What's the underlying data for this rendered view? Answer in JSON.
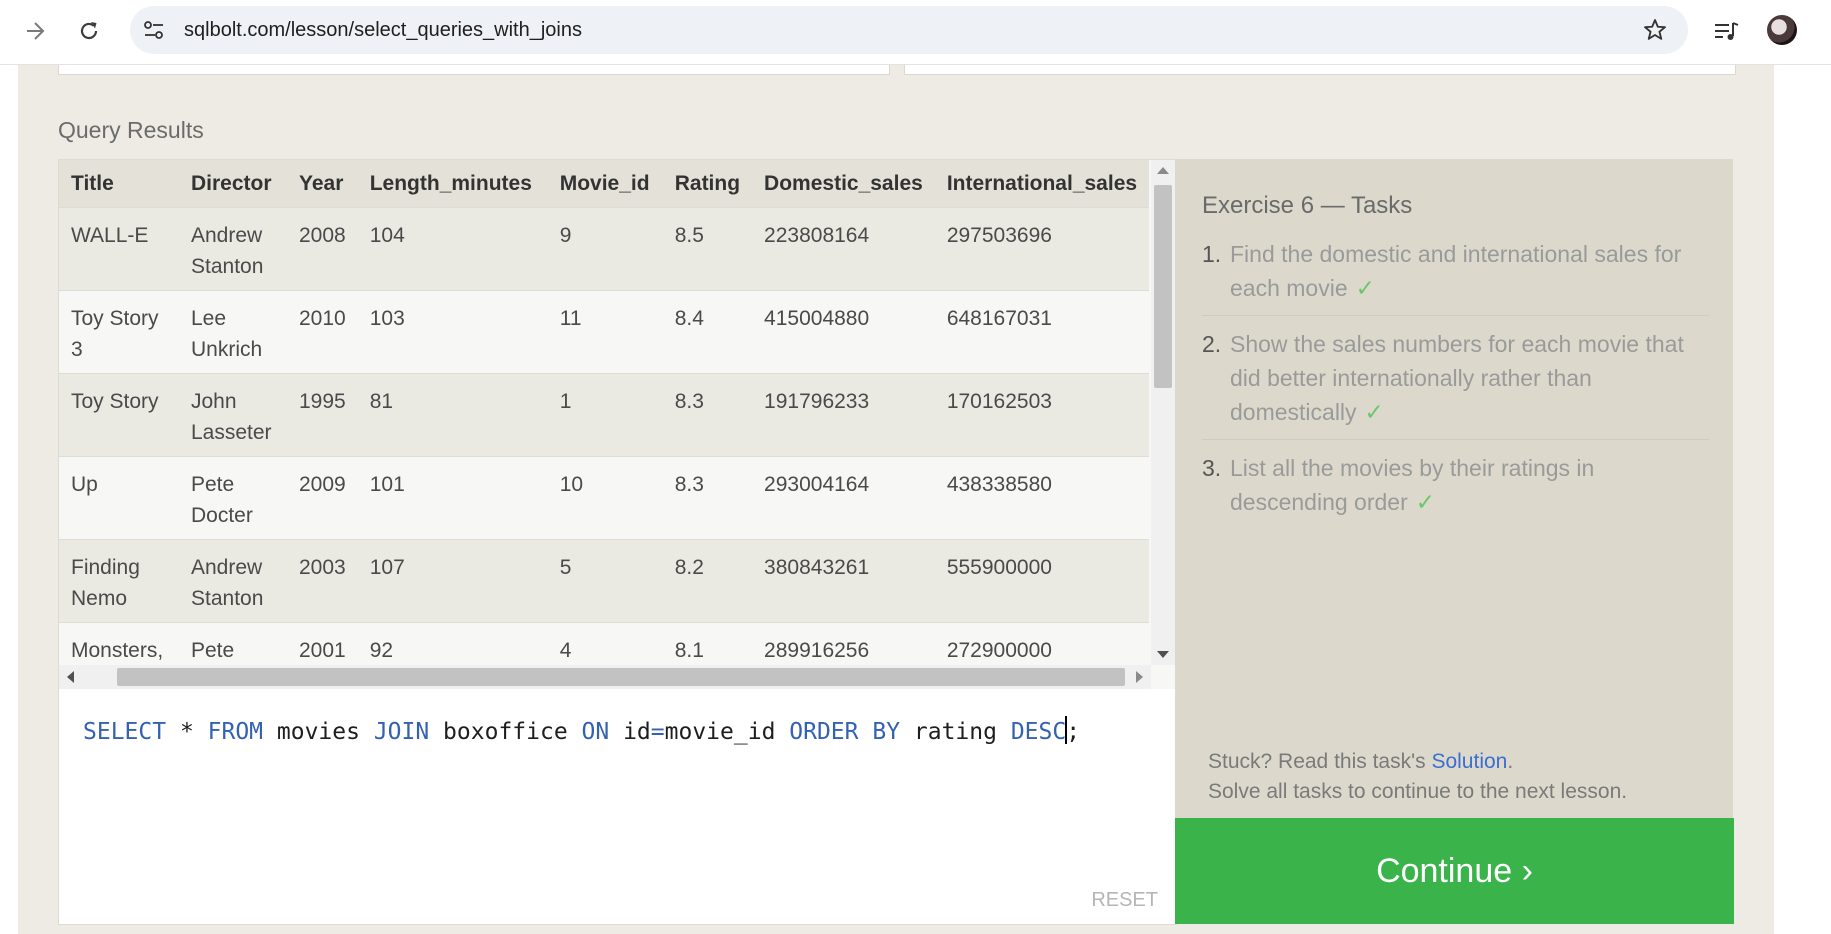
{
  "browser": {
    "url": "sqlbolt.com/lesson/select_queries_with_joins",
    "icons": [
      "back-arrow-icon",
      "reload-icon",
      "site-settings-icon",
      "bookmark-star-icon",
      "media-control-icon",
      "profile-avatar"
    ]
  },
  "results": {
    "label": "Query Results",
    "columns": [
      "Title",
      "Director",
      "Year",
      "Length_minutes",
      "Movie_id",
      "Rating",
      "Domestic_sales",
      "International_sales"
    ],
    "rows": [
      [
        "WALL-E",
        "Andrew Stanton",
        "2008",
        "104",
        "9",
        "8.5",
        "223808164",
        "297503696"
      ],
      [
        "Toy Story 3",
        "Lee Unkrich",
        "2010",
        "103",
        "11",
        "8.4",
        "415004880",
        "648167031"
      ],
      [
        "Toy Story",
        "John Lasseter",
        "1995",
        "81",
        "1",
        "8.3",
        "191796233",
        "170162503"
      ],
      [
        "Up",
        "Pete Docter",
        "2009",
        "101",
        "10",
        "8.3",
        "293004164",
        "438338580"
      ],
      [
        "Finding Nemo",
        "Andrew Stanton",
        "2003",
        "107",
        "5",
        "8.2",
        "380843261",
        "555900000"
      ],
      [
        "Monsters, Inc.",
        "Pete Docter",
        "2001",
        "92",
        "4",
        "8.1",
        "289916256",
        "272900000"
      ]
    ]
  },
  "editor": {
    "tokens": [
      {
        "t": "SELECT",
        "kw": true
      },
      {
        "t": " * ",
        "kw": false
      },
      {
        "t": "FROM",
        "kw": true
      },
      {
        "t": " movies ",
        "kw": false
      },
      {
        "t": "JOIN",
        "kw": true
      },
      {
        "t": " boxoffice ",
        "kw": false
      },
      {
        "t": "ON",
        "kw": true
      },
      {
        "t": " id",
        "kw": false
      },
      {
        "t": "=",
        "kw": true
      },
      {
        "t": "movie_id ",
        "kw": false
      },
      {
        "t": "ORDER BY",
        "kw": true
      },
      {
        "t": " rating ",
        "kw": false
      },
      {
        "t": "DESC",
        "kw": true
      },
      {
        "t": "|",
        "kw": false
      },
      {
        "t": ";",
        "kw": false
      }
    ],
    "reset_label": "RESET"
  },
  "tasks": {
    "title": "Exercise 6 — Tasks",
    "items": [
      {
        "num": "1.",
        "text": "Find the domestic and international sales for each movie",
        "done": "✓"
      },
      {
        "num": "2.",
        "text": "Show the sales numbers for each movie that did better internationally rather than domestically",
        "done": "✓"
      },
      {
        "num": "3.",
        "text": "List all the movies by their ratings in descending order",
        "done": "✓"
      }
    ],
    "help_prefix": "Stuck? Read this task's ",
    "help_link": "Solution",
    "help_suffix": ".",
    "help_line2": "Solve all tasks to continue to the next lesson.",
    "continue_label": "Continue ›"
  },
  "colors": {
    "accent_green": "#3ab34a",
    "keyword_blue": "#3462b3",
    "link_blue": "#3a6fd0",
    "check_green": "#6cc66c"
  }
}
